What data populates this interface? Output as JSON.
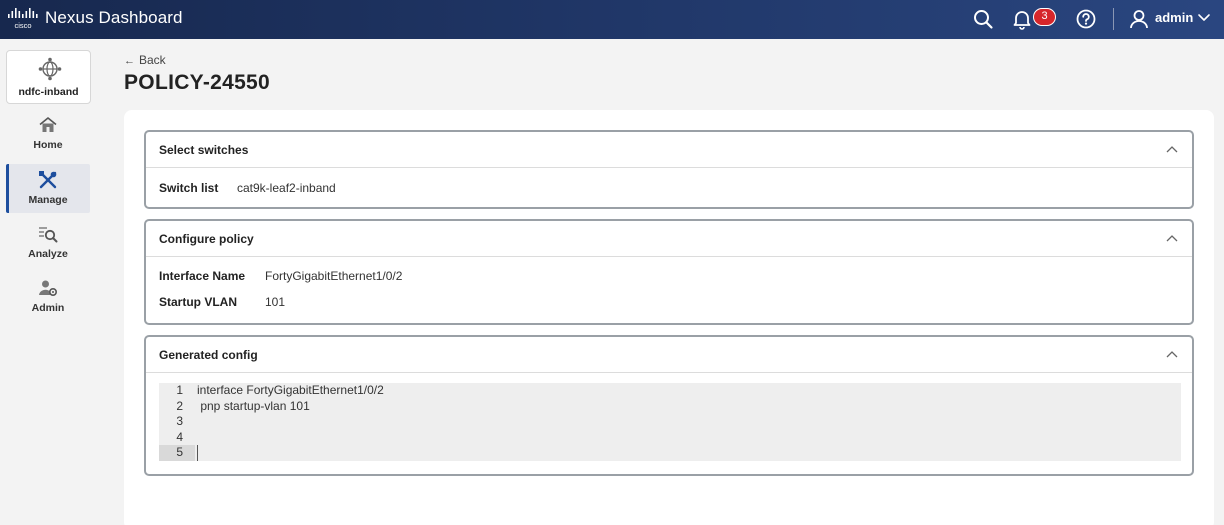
{
  "header": {
    "brand": "cisco",
    "app_title": "Nexus Dashboard",
    "notification_count": "3",
    "user": "admin",
    "icons": [
      "search-icon",
      "bell-icon",
      "help-icon",
      "user-icon",
      "chevron-down-icon"
    ]
  },
  "sidebar": {
    "site": "ndfc-inband",
    "items": [
      {
        "label": "Home",
        "icon": "home-icon"
      },
      {
        "label": "Manage",
        "icon": "tools-icon",
        "active": true
      },
      {
        "label": "Analyze",
        "icon": "analyze-icon"
      },
      {
        "label": "Admin",
        "icon": "admin-icon"
      }
    ]
  },
  "page": {
    "back_label": "Back",
    "title": "POLICY-24550"
  },
  "sections": {
    "select_switches": {
      "title": "Select switches",
      "switch_list_label": "Switch list",
      "switch_list_value": "cat9k-leaf2-inband"
    },
    "configure_policy": {
      "title": "Configure policy",
      "interface_name_label": "Interface Name",
      "interface_name_value": "FortyGigabitEthernet1/0/2",
      "startup_vlan_label": "Startup VLAN",
      "startup_vlan_value": "101"
    },
    "generated_config": {
      "title": "Generated config",
      "lines": [
        {
          "n": "1",
          "text": "interface FortyGigabitEthernet1/0/2"
        },
        {
          "n": "2",
          "text": " pnp startup-vlan 101"
        },
        {
          "n": "3",
          "text": ""
        },
        {
          "n": "4",
          "text": ""
        },
        {
          "n": "5",
          "text": ""
        }
      ]
    }
  },
  "colors": {
    "topbar_start": "#17284e",
    "topbar_end": "#2a4680",
    "badge": "#d6262b",
    "active_nav_accent": "#1d4e9e"
  }
}
